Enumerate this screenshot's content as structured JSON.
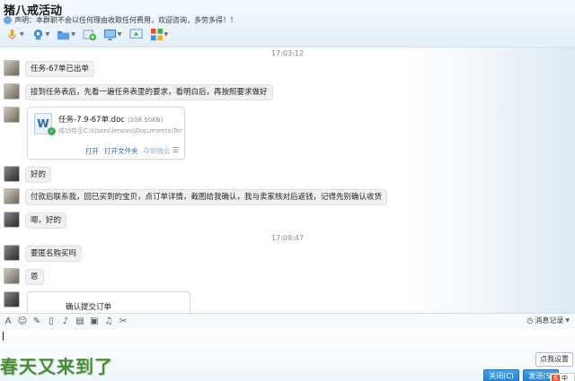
{
  "header": {
    "title": "猪八戒活动",
    "notice": "声明：本群职不会以任何理由收取任何费用，欢迎咨询，多劳多得！！"
  },
  "toolbar": {
    "icons": [
      "mic-icon",
      "camera-icon",
      "folder-icon",
      "add-icon",
      "screen-icon",
      "share-screen-icon",
      "apps-icon"
    ]
  },
  "chat": {
    "timestamps": [
      "17:03:12",
      "17:09:47"
    ],
    "messages": [
      {
        "text": "任务-67单已出单"
      },
      {
        "text": "接到任务表后，先看一遍任务表里的要求，看明白后，再按照要求做好"
      },
      {
        "text": "好的"
      },
      {
        "text": "付款后联系我，回已买到的宝贝，点订单详情，截图给我确认，我与卖家核对后返钱，记得先别确认收货"
      },
      {
        "text": "嗯，好的"
      },
      {
        "text": "要匿名购买吗"
      },
      {
        "text": "恩"
      }
    ],
    "file": {
      "name": "任务-7.9-67单.doc",
      "size": "(208.50KB)",
      "path": "成功存至C:\\Users\\lenovo\\Documents\\Tence...",
      "actions": [
        "打开",
        "打开文件夹",
        "存到微云"
      ],
      "icon_letter": "W"
    },
    "order_card": {
      "title": "确认提交订单"
    }
  },
  "input": {
    "history_label": "消息记录",
    "watermark": "春天又来到了",
    "settings_tip": "点我设置",
    "close_label": "关闭(C)",
    "send_label": "发送(S)",
    "ime_label": "中"
  }
}
